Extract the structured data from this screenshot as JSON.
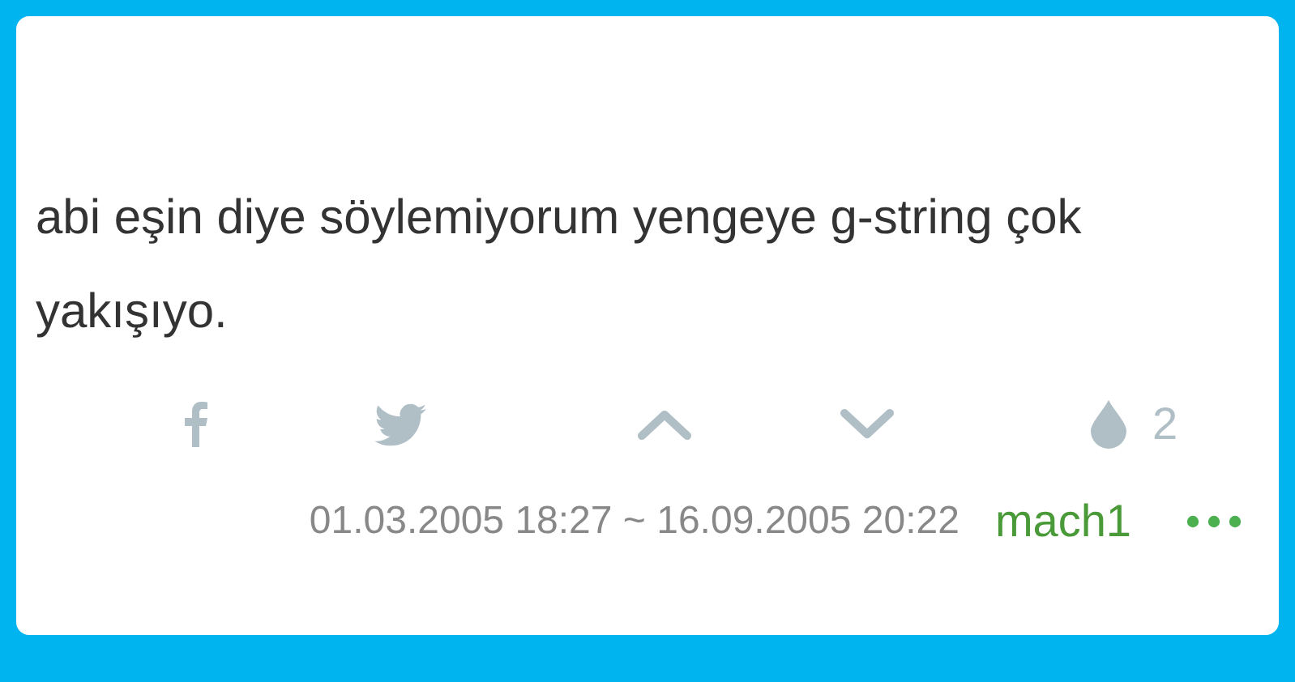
{
  "entry": {
    "text": "abi eşin diye söylemiyorum yengeye g-string çok yakışıyo.",
    "favorite_count": "2",
    "dates": "01.03.2005 18:27 ~ 16.09.2005 20:22",
    "author": "mach1"
  }
}
